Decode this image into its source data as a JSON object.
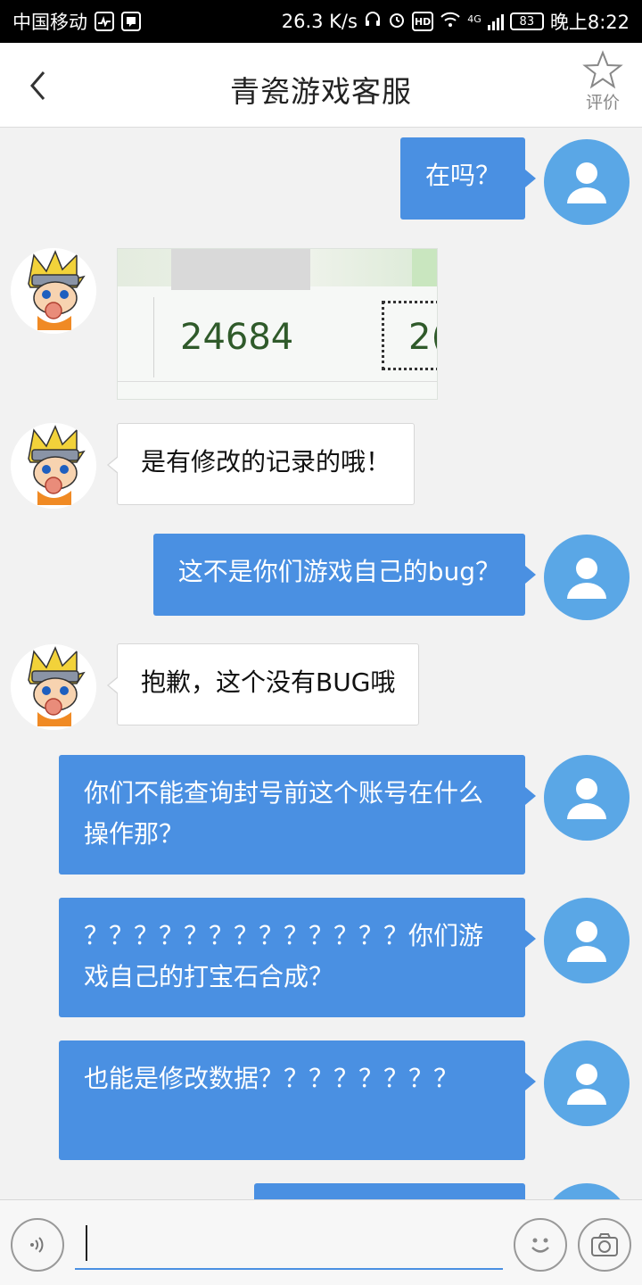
{
  "status_bar": {
    "carrier": "中国移动",
    "speed": "26.3 K/s",
    "hd_label": "HD",
    "network": "4G",
    "battery": "83",
    "time": "晚上8:22"
  },
  "header": {
    "back_glyph": "‹",
    "title": "青瓷游戏客服",
    "rate_label": "评价"
  },
  "messages": [
    {
      "from": "user",
      "text": "在吗？"
    },
    {
      "from": "agent",
      "type": "image",
      "numbers": [
        "24684",
        "2("
      ]
    },
    {
      "from": "agent",
      "text": "是有修改的记录的哦！"
    },
    {
      "from": "user",
      "text": "这不是你们游戏自己的bug？"
    },
    {
      "from": "agent",
      "text": "抱歉，这个没有BUG哦"
    },
    {
      "from": "user",
      "text": "你们不能查询封号前这个账号在什么操作那？"
    },
    {
      "from": "user",
      "text": "？？？？？？？？？？？？？你们游戏自己的打宝石合成？"
    },
    {
      "from": "user",
      "text": "也能是修改数据？？？？？？？？"
    }
  ],
  "input": {
    "placeholder": ""
  },
  "colors": {
    "user_bubble": "#4a90e2",
    "user_avatar": "#5aa7e6",
    "agent_bubble": "#ffffff",
    "background": "#f2f2f2"
  },
  "icons": {
    "back": "chevron-left-icon",
    "rate": "star-outline-icon",
    "voice": "voice-icon",
    "emoji": "smiley-icon",
    "camera": "camera-icon"
  }
}
